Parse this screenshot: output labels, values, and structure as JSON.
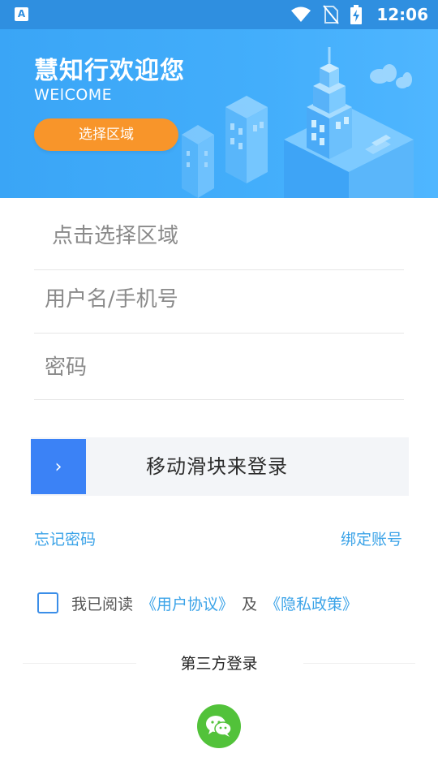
{
  "status_bar": {
    "app_badge": "A",
    "time": "12:06",
    "icons": [
      "wifi-icon",
      "no-sim-icon",
      "battery-charging-icon"
    ]
  },
  "banner": {
    "title": "慧知行欢迎您",
    "subtitle": "WElCOME",
    "region_button_label": "选择区域"
  },
  "form": {
    "region_placeholder": "点击选择区域",
    "username_placeholder": "用户名/手机号",
    "password_placeholder": "密码"
  },
  "slider": {
    "handle_glyph": "›",
    "label": "移动滑块来登录"
  },
  "links": {
    "forgot_password": "忘记密码",
    "bind_account": "绑定账号"
  },
  "agreement": {
    "prefix": "我已阅读",
    "user_agreement": "《用户协议》",
    "conjunction": "及",
    "privacy_policy": "《隐私政策》",
    "checked": false
  },
  "third_party": {
    "label": "第三方登录",
    "providers": [
      "wechat-icon"
    ]
  },
  "colors": {
    "status_bar": "#2f8fe0",
    "banner": "#43aefb",
    "accent_orange": "#f8952a",
    "slider_handle": "#3b82f6",
    "link_blue": "#3ba3e8",
    "wechat_green": "#52c23a"
  }
}
